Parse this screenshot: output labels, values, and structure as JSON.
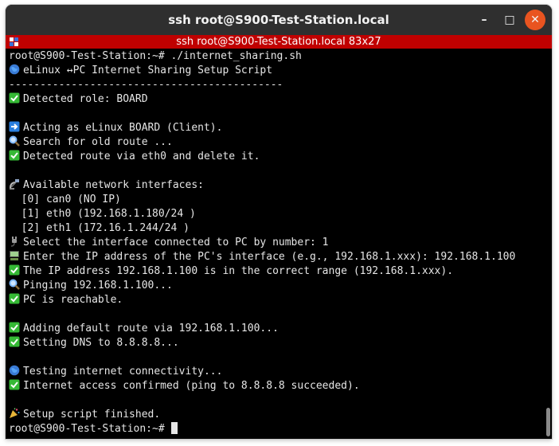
{
  "window": {
    "title": "ssh root@S900-Test-Station.local",
    "tab_title": "ssh root@S900-Test-Station.local 83x27",
    "minimize_glyph": "–",
    "maximize_glyph": "□",
    "close_glyph": "✕"
  },
  "colors": {
    "check": "#35b935",
    "globe": "#3a7bd5",
    "arrow": "#2a7fe0",
    "magnify": "#7cb7ff"
  },
  "terminal": {
    "lines": [
      {
        "icon": "",
        "text": "root@S900-Test-Station:~# ./internet_sharing.sh"
      },
      {
        "icon": "globe-icon",
        "text": "eLinux ↔PC Internet Sharing Setup Script"
      },
      {
        "icon": "",
        "text": "--------------------------------------------"
      },
      {
        "icon": "check-icon",
        "text": "Detected role: BOARD"
      },
      {
        "icon": "",
        "text": ""
      },
      {
        "icon": "arrow-right-icon",
        "text": "Acting as eLinux BOARD (Client)."
      },
      {
        "icon": "magnify-icon",
        "text": "Search for old route ..."
      },
      {
        "icon": "check-icon",
        "text": "Detected route via eth0 and delete it."
      },
      {
        "icon": "",
        "text": ""
      },
      {
        "icon": "satellite-icon",
        "text": "Available network interfaces:"
      },
      {
        "icon": "",
        "text": "  [0] can0 (NO IP)"
      },
      {
        "icon": "",
        "text": "  [1] eth0 (192.168.1.180/24 )"
      },
      {
        "icon": "",
        "text": "  [2] eth1 (172.16.1.244/24 )"
      },
      {
        "icon": "plug-icon",
        "text": "Select the interface connected to PC by number: 1"
      },
      {
        "icon": "computer-icon",
        "text": "Enter the IP address of the PC's interface (e.g., 192.168.1.xxx): 192.168.1.100"
      },
      {
        "icon": "check-icon",
        "text": "The IP address 192.168.1.100 is in the correct range (192.168.1.xxx)."
      },
      {
        "icon": "magnify-icon",
        "text": "Pinging 192.168.1.100..."
      },
      {
        "icon": "check-icon",
        "text": "PC is reachable."
      },
      {
        "icon": "",
        "text": ""
      },
      {
        "icon": "check-icon",
        "text": "Adding default route via 192.168.1.100..."
      },
      {
        "icon": "check-icon",
        "text": "Setting DNS to 8.8.8.8..."
      },
      {
        "icon": "",
        "text": ""
      },
      {
        "icon": "globe-icon",
        "text": "Testing internet connectivity..."
      },
      {
        "icon": "check-icon",
        "text": "Internet access confirmed (ping to 8.8.8.8 succeeded)."
      },
      {
        "icon": "",
        "text": ""
      },
      {
        "icon": "party-icon",
        "text": "Setup script finished."
      }
    ],
    "prompt": "root@S900-Test-Station:~# "
  }
}
